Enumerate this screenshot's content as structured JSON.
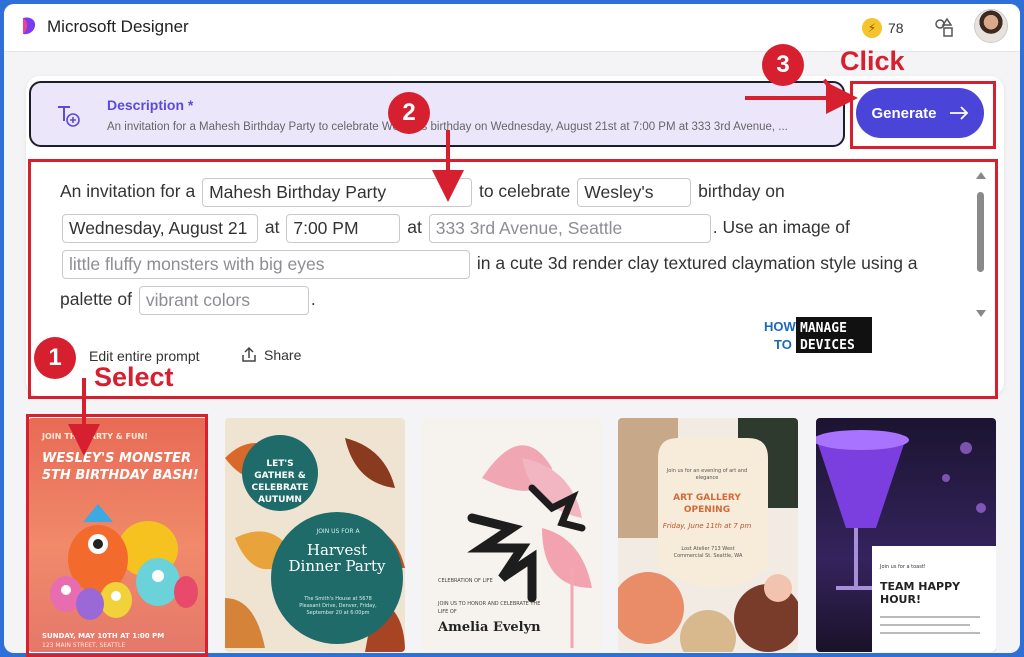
{
  "header": {
    "app_title": "Microsoft Designer",
    "credits": "78",
    "icons": [
      "designer-logo-icon",
      "coin-icon",
      "shapes-icon",
      "avatar"
    ]
  },
  "description": {
    "label": "Description *",
    "text": "An invitation for a Mahesh Birthday Party to celebrate Wesley's birthday on Wednesday, August 21st at 7:00 PM at 333 3rd Avenue, ..."
  },
  "generate": {
    "label": "Generate"
  },
  "prompt": {
    "line1": {
      "t1": "An invitation for a",
      "f1": "Mahesh Birthday Party",
      "t2": "to celebrate",
      "f2": "Wesley's",
      "t3": "birthday on"
    },
    "line2": {
      "f1": "Wednesday, August 21",
      "t1": "at",
      "f2": "7:00 PM",
      "t2": "at",
      "f3": "333 3rd Avenue, Seattle",
      "t3": ". Use an image of"
    },
    "line3": {
      "f1": "little fluffy monsters with big eyes",
      "t1": "in a cute 3d render clay textured claymation style using a"
    },
    "line4": {
      "t1": "palette of",
      "f1": "vibrant colors",
      "t2": "."
    }
  },
  "actions": {
    "edit": "Edit entire prompt",
    "share": "Share"
  },
  "watermark": {
    "how": "HOW",
    "to": "TO",
    "manage": "MANAGE",
    "devices": "DEVICES"
  },
  "annotations": {
    "step1": "1",
    "step1_text": "Select",
    "step2": "2",
    "step3": "3",
    "step3_text": "Click"
  },
  "cards": [
    {
      "top": "JOIN THE PARTY & FUN!",
      "title": "WESLEY'S MONSTER 5TH BIRTHDAY BASH!",
      "footer1": "SUNDAY, MAY 10TH AT 1:00 PM",
      "footer2": "123 MAIN STREET, SEATTLE"
    },
    {
      "badge": "LET'S GATHER & CELEBRATE AUTUMN",
      "join": "JOIN US FOR A",
      "title": "Harvest Dinner Party",
      "sub": "The Smith's House at 5678 Pleasant Drive, Denver, Friday, September 20 at 6:00pm"
    },
    {
      "tag": "CELEBRATION OF LIFE",
      "join": "JOIN US TO HONOR AND CELEBRATE THE LIFE OF",
      "name": "Amelia Evelyn"
    },
    {
      "top": "Join us for an evening of art and elegance",
      "title": "ART GALLERY OPENING",
      "date": "Friday, June 11th at 7 pm",
      "place": "Lost Atelier 713 West Commercial St. Seattle, WA"
    },
    {
      "top": "Join us for a toast!",
      "title": "TEAM HAPPY HOUR!"
    }
  ],
  "colors": {
    "accent": "#4a44d8",
    "annotation": "#d6202f",
    "description_bg": "#ece6fb"
  }
}
